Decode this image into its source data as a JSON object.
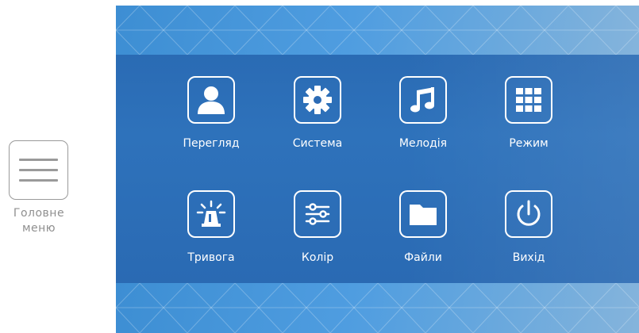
{
  "side_menu": {
    "label": "Головне меню",
    "icon": "hamburger-menu-icon"
  },
  "menu": {
    "items": [
      {
        "label": "Перегляд",
        "icon": "person-icon"
      },
      {
        "label": "Система",
        "icon": "gear-icon"
      },
      {
        "label": "Мелодія",
        "icon": "music-note-icon"
      },
      {
        "label": "Режим",
        "icon": "grid-icon"
      },
      {
        "label": "Тривога",
        "icon": "alarm-siren-icon"
      },
      {
        "label": "Колір",
        "icon": "sliders-icon"
      },
      {
        "label": "Файли",
        "icon": "folder-icon"
      },
      {
        "label": "Вихід",
        "icon": "power-icon"
      }
    ]
  },
  "colors": {
    "accent": "#2c6bb5",
    "pattern": "#4f9de0",
    "icon": "#ffffff",
    "side": "#9a9a9a"
  }
}
